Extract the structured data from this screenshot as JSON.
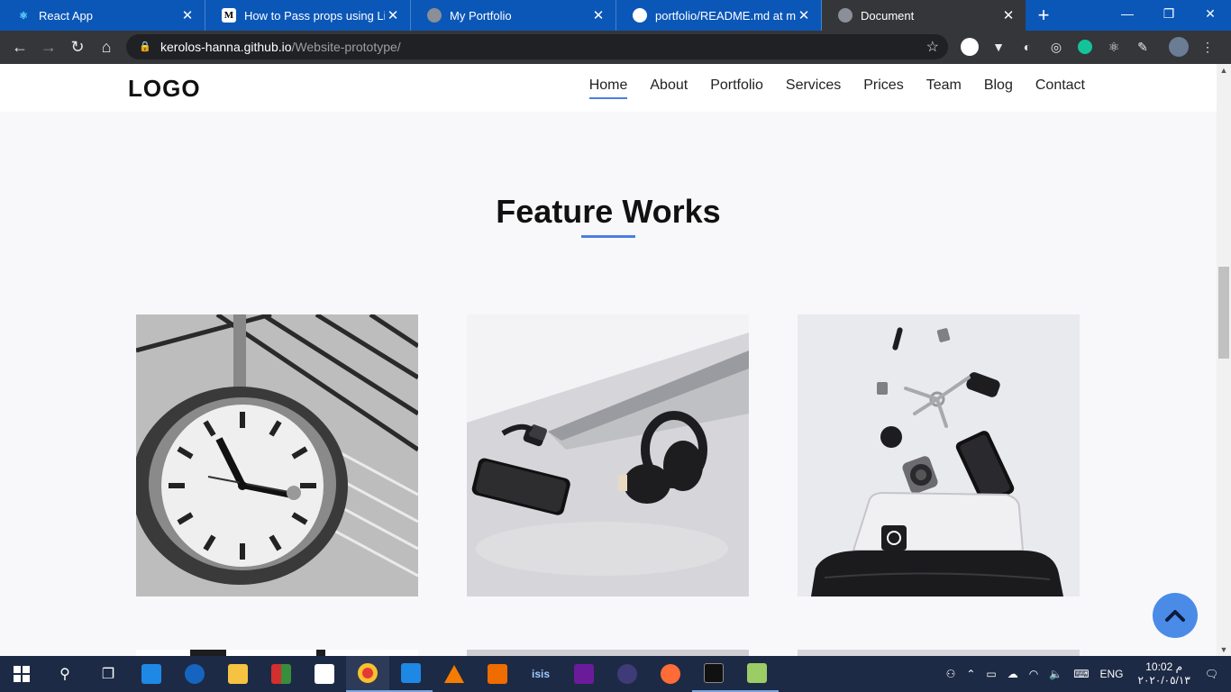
{
  "browser": {
    "tabs": [
      {
        "title": "React App",
        "favicon": "react-icon",
        "color": "#61dafb"
      },
      {
        "title": "How to Pass props using Link a",
        "favicon": "medium-icon",
        "color": "#000000"
      },
      {
        "title": "My Portfolio",
        "favicon": "globe-icon",
        "color": "#8a8f98"
      },
      {
        "title": "portfolio/README.md at maste",
        "favicon": "github-icon",
        "color": "#ffffff"
      },
      {
        "title": "Document",
        "favicon": "globe-icon",
        "color": "#8a8f98"
      }
    ],
    "new_tab_label": "+",
    "url_host": "kerolos-hanna.github.io",
    "url_path": "/Website-prototype/"
  },
  "site": {
    "logo": "LOGO",
    "nav": [
      "Home",
      "About",
      "Portfolio",
      "Services",
      "Prices",
      "Team",
      "Blog",
      "Contact"
    ],
    "active_nav": "Home",
    "section_title": "Feature Works",
    "accent_color": "#4a7fe0",
    "works": [
      {
        "image": "station-clock"
      },
      {
        "image": "laptop-headphones-phone"
      },
      {
        "image": "keys-phone-camera-bag"
      }
    ]
  },
  "taskbar": {
    "language": "ENG",
    "time": "10:02 م",
    "date": "٢٠٢٠/٠٥/١٣"
  }
}
